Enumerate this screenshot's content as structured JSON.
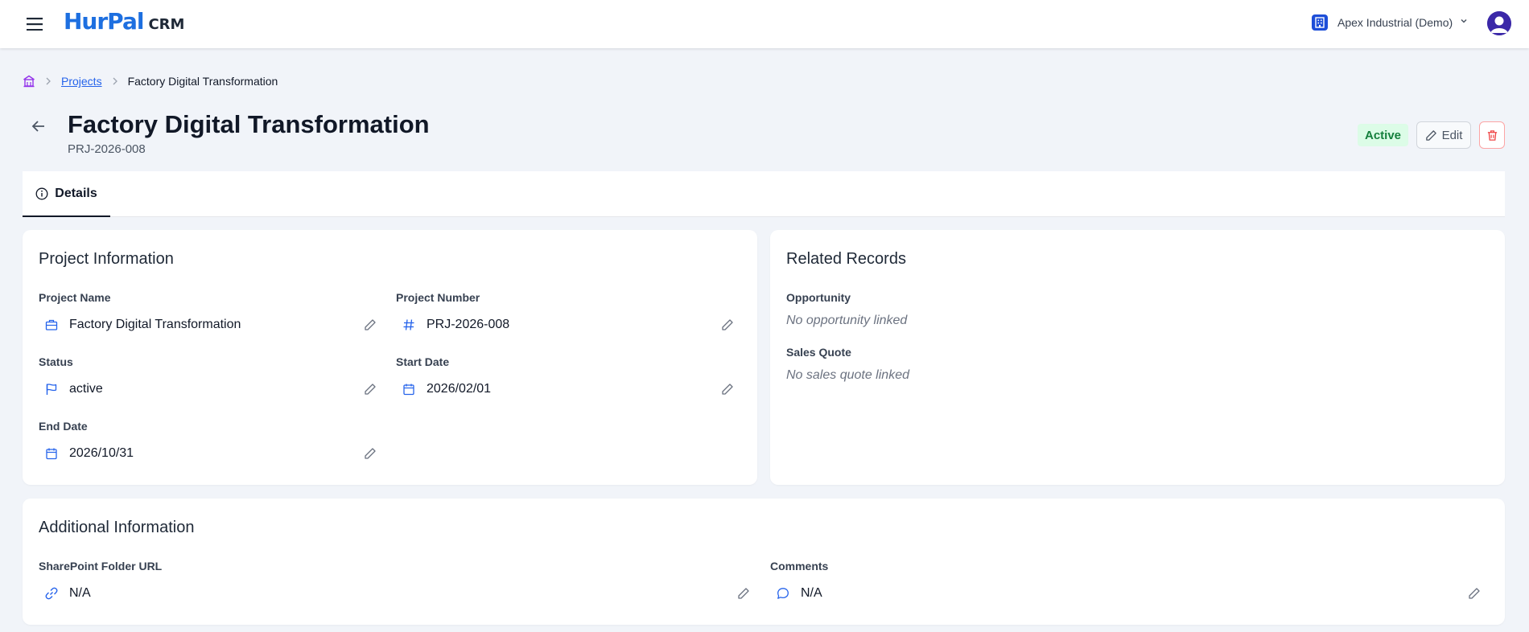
{
  "app": {
    "logo_main": "HurPal",
    "logo_sub": "CRM"
  },
  "org": {
    "name": "Apex Industrial (Demo)"
  },
  "breadcrumb": {
    "projects": "Projects",
    "current": "Factory Digital Transformation"
  },
  "header": {
    "title": "Factory Digital Transformation",
    "number": "PRJ-2026-008",
    "status": "Active",
    "edit_label": "Edit"
  },
  "tabs": [
    {
      "label": "Details"
    }
  ],
  "project_info": {
    "title": "Project Information",
    "fields": {
      "name": {
        "label": "Project Name",
        "value": "Factory Digital Transformation"
      },
      "number": {
        "label": "Project Number",
        "value": "PRJ-2026-008"
      },
      "status": {
        "label": "Status",
        "value": "active"
      },
      "start": {
        "label": "Start Date",
        "value": "2026/02/01"
      },
      "end": {
        "label": "End Date",
        "value": "2026/10/31"
      }
    }
  },
  "related": {
    "title": "Related Records",
    "opportunity": {
      "label": "Opportunity",
      "empty": "No opportunity linked"
    },
    "quote": {
      "label": "Sales Quote",
      "empty": "No sales quote linked"
    }
  },
  "additional": {
    "title": "Additional Information",
    "sharepoint": {
      "label": "SharePoint Folder URL",
      "value": "N/A"
    },
    "comments": {
      "label": "Comments",
      "value": "N/A"
    }
  },
  "colors": {
    "accent": "#2563eb",
    "brand": "#1d6fe0",
    "success_bg": "#dcfce7",
    "success_text": "#15803d",
    "danger": "#ef4444"
  },
  "icons": {
    "menu": "hamburger-icon",
    "org": "building-icon",
    "home": "home-icon",
    "back": "arrow-left-icon",
    "edit": "pencil-icon",
    "delete": "trash-icon",
    "info": "info-circle-icon",
    "briefcase": "briefcase-icon",
    "hash": "hash-icon",
    "flag": "flag-icon",
    "calendar": "calendar-icon",
    "link": "link-icon",
    "comment": "message-circle-icon"
  }
}
